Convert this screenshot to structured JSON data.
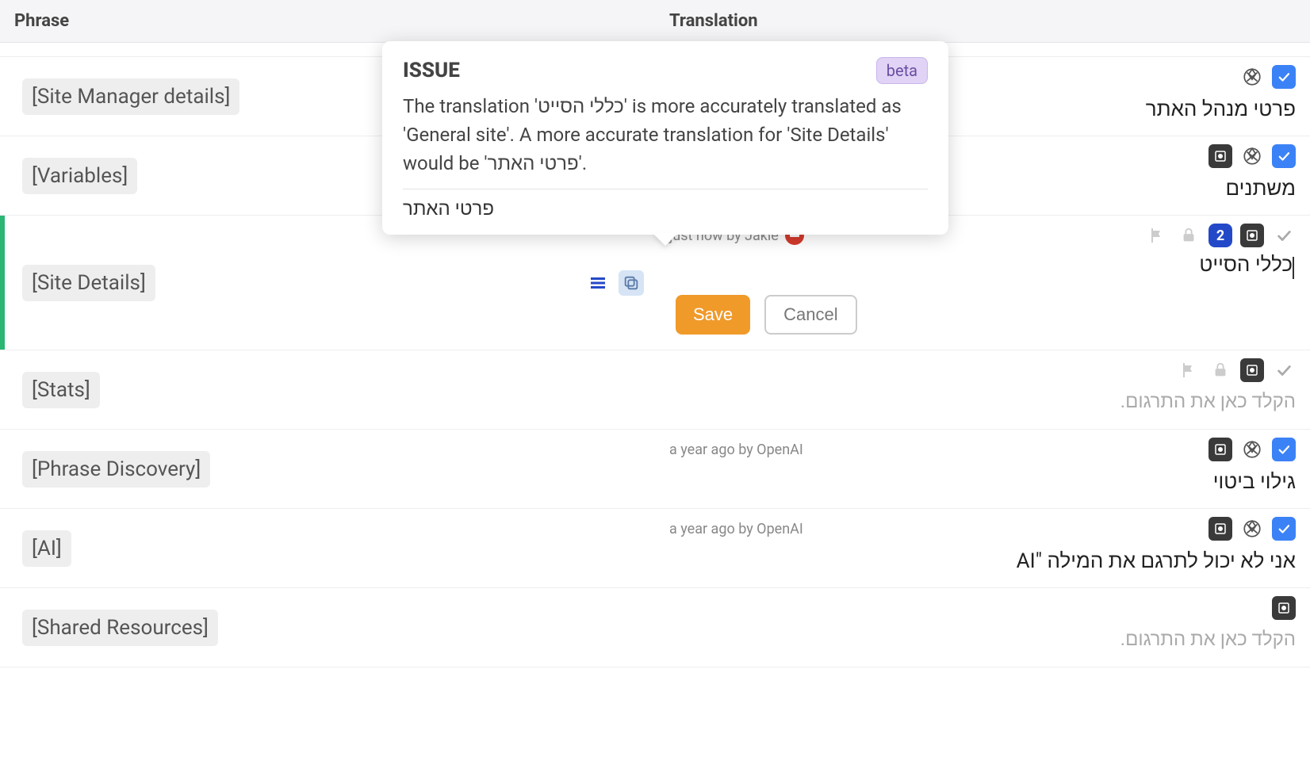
{
  "headers": {
    "phrase": "Phrase",
    "translation": "Translation"
  },
  "popover": {
    "title": "ISSUE",
    "badge": "beta",
    "body": "The translation 'כללי הסייט' is more accurately translated as 'General site'. A more accurate translation for 'Site Details' would be 'פרטי האתר'.",
    "suggestion": "פרטי האתר"
  },
  "buttons": {
    "save": "Save",
    "cancel": "Cancel"
  },
  "placeholder": "הקלד כאן את התרגום.",
  "rows": [
    {
      "phrase": "[Site Manager details]",
      "meta": "",
      "translation": "פרטי מנהל האתר",
      "icons": [
        "openai",
        "check"
      ]
    },
    {
      "phrase": "[Variables]",
      "meta": "",
      "translation": "משתנים",
      "icons": [
        "target",
        "openai",
        "check"
      ]
    },
    {
      "phrase": "[Site Details]",
      "meta": "just now by Jakie",
      "translation": "כללי הסייט",
      "active": true,
      "badge2": "2",
      "icons": [
        "flag",
        "lock",
        "badge2",
        "target",
        "check-empty"
      ]
    },
    {
      "phrase": "[Stats]",
      "meta": "",
      "translation": "",
      "placeholder": true,
      "icons": [
        "flag",
        "lock",
        "target",
        "check-empty"
      ]
    },
    {
      "phrase": "[Phrase Discovery]",
      "meta": "a year ago by OpenAI",
      "translation": "גילוי ביטוי",
      "icons": [
        "target",
        "openai",
        "check"
      ]
    },
    {
      "phrase": "[AI]",
      "meta": "a year ago by OpenAI",
      "translation": "אני לא יכול לתרגם את המילה \"AI",
      "icons": [
        "target",
        "openai",
        "check"
      ]
    },
    {
      "phrase": "[Shared Resources]",
      "meta": "",
      "translation": "",
      "placeholder": true,
      "icons": [
        "target"
      ]
    }
  ]
}
